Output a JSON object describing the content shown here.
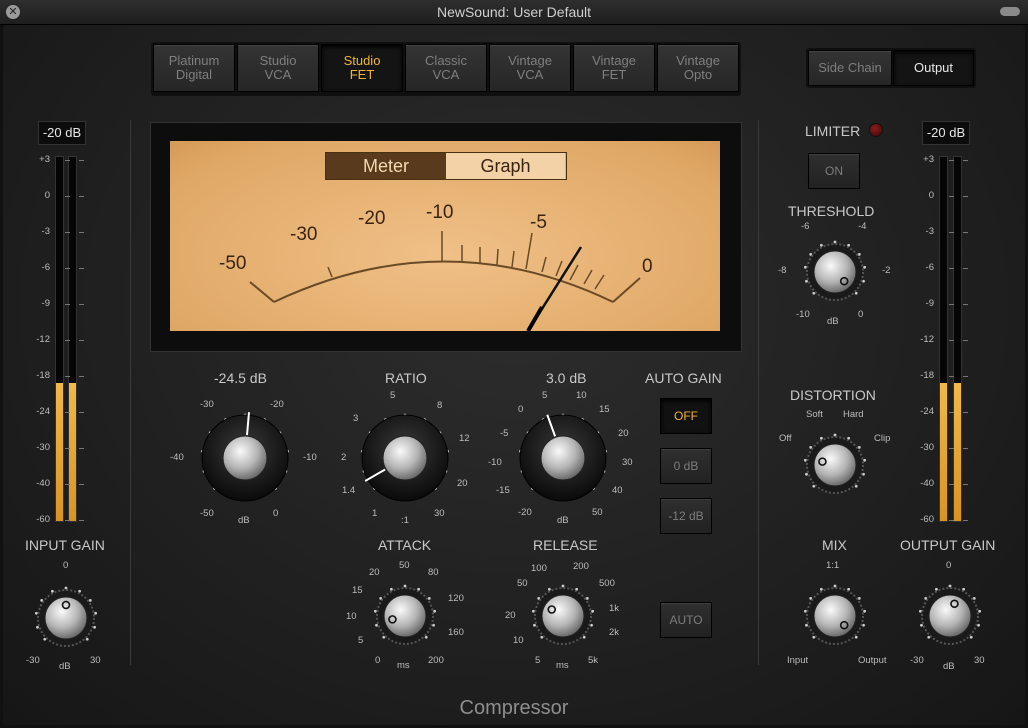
{
  "window": {
    "title": "NewSound: User Default"
  },
  "models": [
    {
      "label": "Platinum\nDigital",
      "selected": false
    },
    {
      "label": "Studio\nVCA",
      "selected": false
    },
    {
      "label": "Studio\nFET",
      "selected": true
    },
    {
      "label": "Classic\nVCA",
      "selected": false
    },
    {
      "label": "Vintage\nVCA",
      "selected": false
    },
    {
      "label": "Vintage\nFET",
      "selected": false
    },
    {
      "label": "Vintage\nOpto",
      "selected": false
    }
  ],
  "view_toggle": {
    "side_chain": "Side Chain",
    "output": "Output"
  },
  "meter_tabs": {
    "meter": "Meter",
    "graph": "Graph"
  },
  "vu_scale": [
    "-50",
    "-30",
    "-20",
    "-10",
    "-5",
    "0"
  ],
  "input_meter": {
    "readout": "-20 dB",
    "level_fraction": 0.38
  },
  "output_meter": {
    "readout": "-20 dB",
    "level_fraction": 0.38
  },
  "meter_scale": [
    "+3",
    "0",
    "-3",
    "-6",
    "-9",
    "-12",
    "-18",
    "-24",
    "-30",
    "-40",
    "-60"
  ],
  "threshold_main": {
    "value": "-24.5 dB",
    "ticks": [
      "-30",
      "-20",
      "-40",
      "-10",
      "-50",
      "0"
    ],
    "unit": "dB"
  },
  "ratio": {
    "label": "RATIO",
    "ticks": [
      "5",
      "8",
      "3",
      "12",
      "2",
      "20",
      "1.4",
      "1",
      "30"
    ],
    "unit": ":1"
  },
  "makeup": {
    "value": "3.0 dB",
    "ticks": [
      "5",
      "10",
      "0",
      "15",
      "-5",
      "20",
      "-10",
      "30",
      "-15",
      "40",
      "-20",
      "50"
    ],
    "unit": "dB"
  },
  "auto_gain": {
    "label": "AUTO GAIN",
    "options": [
      "OFF",
      "0 dB",
      "-12 dB"
    ],
    "selected": "OFF"
  },
  "attack": {
    "label": "ATTACK",
    "ticks": [
      "50",
      "20",
      "80",
      "15",
      "120",
      "10",
      "160",
      "5",
      "0",
      "200"
    ],
    "unit": "ms"
  },
  "release": {
    "label": "RELEASE",
    "ticks": [
      "100",
      "200",
      "50",
      "500",
      "20",
      "1k",
      "10",
      "2k",
      "5",
      "5k"
    ],
    "unit": "ms",
    "auto": "AUTO"
  },
  "input_gain": {
    "label": "INPUT GAIN",
    "ticks": [
      "0",
      "-30",
      "30"
    ],
    "unit": "dB"
  },
  "limiter": {
    "label": "LIMITER",
    "button": "ON"
  },
  "threshold_limiter": {
    "label": "THRESHOLD",
    "ticks": [
      "-6",
      "-4",
      "-8",
      "-2",
      "-10",
      "0"
    ],
    "unit": "dB"
  },
  "distortion": {
    "label": "DISTORTION",
    "ticks": [
      "Soft",
      "Hard",
      "Off",
      "Clip"
    ]
  },
  "mix": {
    "label": "MIX",
    "ticks": [
      "1:1",
      "Input",
      "Output"
    ]
  },
  "output_gain": {
    "label": "OUTPUT GAIN",
    "ticks": [
      "0",
      "-30",
      "30"
    ],
    "unit": "dB"
  },
  "footer": {
    "title": "Compressor"
  },
  "colors": {
    "accent": "#f2b630",
    "vu_face": "#e8b37a",
    "panel": "#262626"
  }
}
